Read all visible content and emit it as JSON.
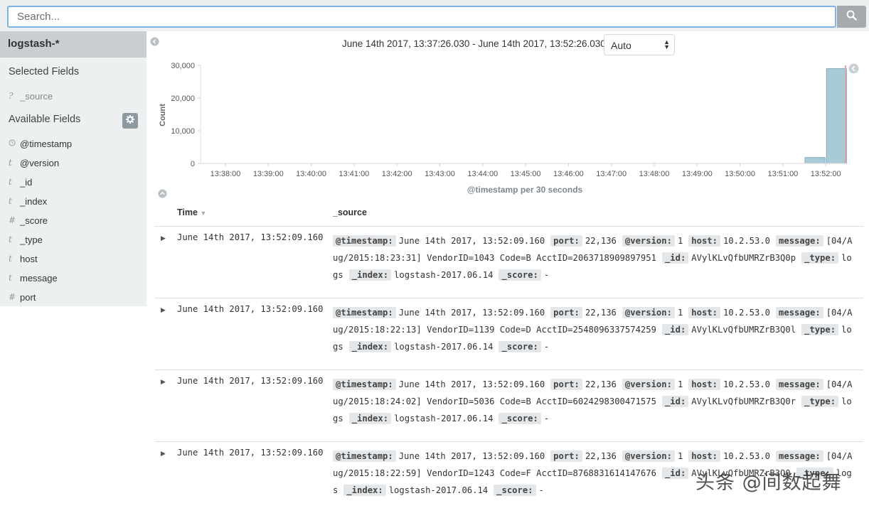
{
  "search": {
    "placeholder": "Search...",
    "button_icon": "search-icon"
  },
  "sidebar": {
    "index_pattern": "logstash-*",
    "selected_title": "Selected Fields",
    "selected_fields": [
      {
        "type": "?",
        "name": "_source"
      }
    ],
    "available_title": "Available Fields",
    "settings_icon": "gear-icon",
    "available_fields": [
      {
        "type": "clock",
        "name": "@timestamp"
      },
      {
        "type": "t",
        "name": "@version"
      },
      {
        "type": "t",
        "name": "_id"
      },
      {
        "type": "t",
        "name": "_index"
      },
      {
        "type": "#",
        "name": "_score"
      },
      {
        "type": "t",
        "name": "_type"
      },
      {
        "type": "t",
        "name": "host"
      },
      {
        "type": "t",
        "name": "message"
      },
      {
        "type": "#",
        "name": "port"
      }
    ]
  },
  "histogram": {
    "time_range": "June 14th 2017, 13:37:26.030 - June 14th 2017, 13:52:26.030 —",
    "interval": "Auto"
  },
  "chart_data": {
    "type": "bar",
    "xlabel": "@timestamp per 30 seconds",
    "ylabel": "Count",
    "ylim": [
      0,
      30000
    ],
    "y_ticks": [
      "30,000",
      "20,000",
      "10,000",
      "0"
    ],
    "x_ticks": [
      "13:38:00",
      "13:39:00",
      "13:40:00",
      "13:41:00",
      "13:42:00",
      "13:43:00",
      "13:44:00",
      "13:45:00",
      "13:46:00",
      "13:47:00",
      "13:48:00",
      "13:49:00",
      "13:50:00",
      "13:51:00",
      "13:52:00"
    ],
    "bars": [
      {
        "x": "13:51:30",
        "value": 1800
      },
      {
        "x": "13:52:00",
        "value": 29000
      }
    ],
    "grid": false,
    "colors": {
      "bar": "#a8cbd8",
      "bar_stroke": "#7fa9ba",
      "now_marker": "#e8a0a0"
    }
  },
  "table": {
    "col_time": "Time",
    "col_source": "_source",
    "rows": [
      {
        "time": "June 14th 2017, 13:52:09.160",
        "timestamp": "June 14th 2017, 13:52:09.160",
        "port": "22,136",
        "version": "1",
        "host": "10.2.53.0",
        "message": "[04/Aug/2015:18:23:31] VendorID=1043 Code=B AcctID=2063718909897951",
        "id": "AVylKLvQfbUMRZrB3Q0p",
        "type": "logs",
        "index": "logstash-2017.06.14",
        "score": "-"
      },
      {
        "time": "June 14th 2017, 13:52:09.160",
        "timestamp": "June 14th 2017, 13:52:09.160",
        "port": "22,136",
        "version": "1",
        "host": "10.2.53.0",
        "message": "[04/Aug/2015:18:22:13] VendorID=1139 Code=D AcctID=2548096337574259",
        "id": "AVylKLvQfbUMRZrB3Q0l",
        "type": "logs",
        "index": "logstash-2017.06.14",
        "score": "-"
      },
      {
        "time": "June 14th 2017, 13:52:09.160",
        "timestamp": "June 14th 2017, 13:52:09.160",
        "port": "22,136",
        "version": "1",
        "host": "10.2.53.0",
        "message": "[04/Aug/2015:18:24:02] VendorID=5036 Code=B AcctID=6024298300471575",
        "id": "AVylKLvQfbUMRZrB3Q0r",
        "type": "logs",
        "index": "logstash-2017.06.14",
        "score": "-"
      },
      {
        "time": "June 14th 2017, 13:52:09.160",
        "timestamp": "June 14th 2017, 13:52:09.160",
        "port": "22,136",
        "version": "1",
        "host": "10.2.53.0",
        "message": "[04/Aug/2015:18:22:59] VendorID=1243 Code=F AcctID=8768831614147676",
        "id": "AVylKLvQfbUMRZrB3Q0",
        "type": "logs",
        "index": "logstash-2017.06.14",
        "score": "-"
      }
    ]
  },
  "watermark": "头条 @间数起舞"
}
